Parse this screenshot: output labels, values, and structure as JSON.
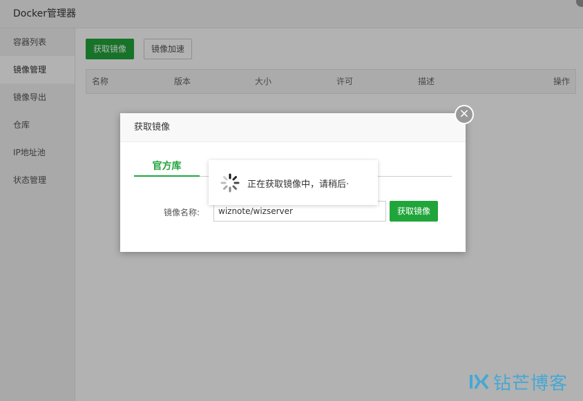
{
  "window": {
    "title": "Docker管理器"
  },
  "sidebar": {
    "items": [
      {
        "label": "容器列表"
      },
      {
        "label": "镜像管理"
      },
      {
        "label": "镜像导出"
      },
      {
        "label": "仓库"
      },
      {
        "label": "IP地址池"
      },
      {
        "label": "状态管理"
      }
    ],
    "active_index": 1
  },
  "toolbar": {
    "pull_label": "获取镜像",
    "accelerate_label": "镜像加速"
  },
  "table": {
    "columns": [
      "名称",
      "版本",
      "大小",
      "许可",
      "描述",
      "操作"
    ]
  },
  "modal": {
    "title": "获取镜像",
    "close_symbol": "×",
    "tab_label": "官方库",
    "field_label": "镜像名称:",
    "field_value": "wiznote/wizserver",
    "submit_label": "获取镜像"
  },
  "loading": {
    "text": "正在获取镜像中，请稍后·"
  },
  "watermark": {
    "text": "钻芒博客"
  },
  "colors": {
    "accent": "#20a53a",
    "overlay": "rgba(0,0,0,0.3)",
    "watermark": "#3aa8d8"
  }
}
